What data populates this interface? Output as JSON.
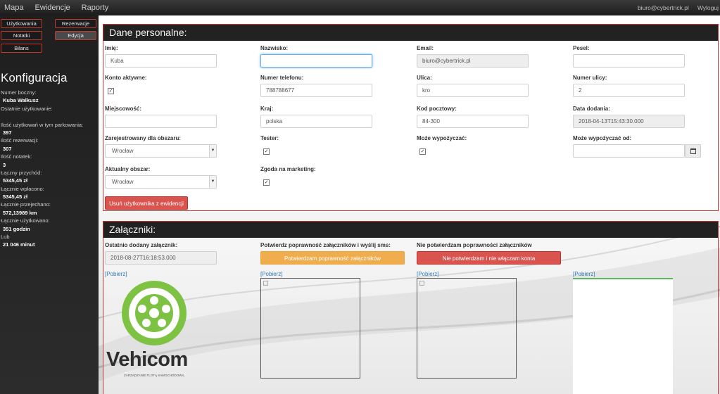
{
  "nav": {
    "items": [
      "Mapa",
      "Ewidencje",
      "Raporty"
    ],
    "email": "biuro@cybertrick.pl",
    "logout": "Wyloguj"
  },
  "sidebar": {
    "buttons": [
      "Użytkowania",
      "Rezerwacje",
      "Notatki",
      "Edycja",
      "Bilans"
    ],
    "title": "Konfiguracja",
    "stats": [
      {
        "label": "Numer boczny:",
        "value": ""
      },
      {
        "label": "",
        "value": "Kuba Walkusz"
      },
      {
        "label": "Ostatnie użytkowanie:",
        "value": ""
      },
      {
        "label": "Ilość użytkowań w tym parkowania:",
        "value": "397"
      },
      {
        "label": "Ilość rezerwacji:",
        "value": "307"
      },
      {
        "label": "Ilość notatek:",
        "value": "3"
      },
      {
        "label": "Łączny przychód:",
        "value": "5345,45 zł"
      },
      {
        "label": "Łącznie wpłacono:",
        "value": "5345,45 zł"
      },
      {
        "label": "Łącznie przejechano:",
        "value": "572,13989 km"
      },
      {
        "label": "Łącznie użytkowano:",
        "value": "351 godzin"
      },
      {
        "label": "Lub",
        "value": "21 046 minut"
      }
    ]
  },
  "personal": {
    "title": "Dane personalne:",
    "imie_label": "Imię:",
    "imie_value": "Kuba",
    "nazwisko_label": "Nazwisko:",
    "nazwisko_value": "",
    "email_label": "Email:",
    "email_value": "biuro@cybertrick.pl",
    "pesel_label": "Pesel:",
    "pesel_value": "",
    "konto_label": "Konto aktywne:",
    "telefon_label": "Numer telefonu:",
    "telefon_value": "788788677",
    "ulica_label": "Ulica:",
    "ulica_value": "kro",
    "nr_ulicy_label": "Numer ulicy:",
    "nr_ulicy_value": "2",
    "miejscowosc_label": "Miejscowość:",
    "miejscowosc_value": "",
    "kraj_label": "Kraj:",
    "kraj_value": "polska",
    "kod_label": "Kod pocztowy:",
    "kod_value": "84-300",
    "data_dodania_label": "Data dodania:",
    "data_dodania_value": "2018-04-13T15:43:30.000",
    "obszar_label": "Zarejestrowany dla obszaru:",
    "obszar_value": "Wrocław",
    "tester_label": "Tester:",
    "moze_wyp_label": "Może wypożyczać:",
    "moze_wyp_od_label": "Może wypożyczać od:",
    "moze_wyp_od_value": "",
    "aktualny_label": "Aktualny obszar:",
    "aktualny_value": "Wrocław",
    "marketing_label": "Zgoda na marketing:",
    "delete_button": "Usuń użytkownika z ewidencji"
  },
  "attachments": {
    "title": "Załączniki:",
    "last_label": "Ostatnio dodany załącznik:",
    "last_value": "2018-08-27T16:18:53.000",
    "confirm_label": "Potwierdz poprawność załączników i wyślij sms:",
    "confirm_button": "Potwierdzam poprawność załączników",
    "reject_label": "Nie potwierdzam poprawności załączników",
    "reject_button": "Nie potwierdzam i nie włączam konta",
    "download_link": "[Pobierz]"
  },
  "logo": {
    "text": "Vehicom",
    "subtitle": "ZARZĄDZANIE FLOTĄ SAMOCHODOWĄ",
    "brand_green": "#7dc242",
    "brand_dark": "#2d2d2d"
  },
  "colors": {
    "accent_red": "#c0392b",
    "danger": "#d9534f",
    "warning": "#f0ad4e",
    "link": "#337ab7"
  }
}
